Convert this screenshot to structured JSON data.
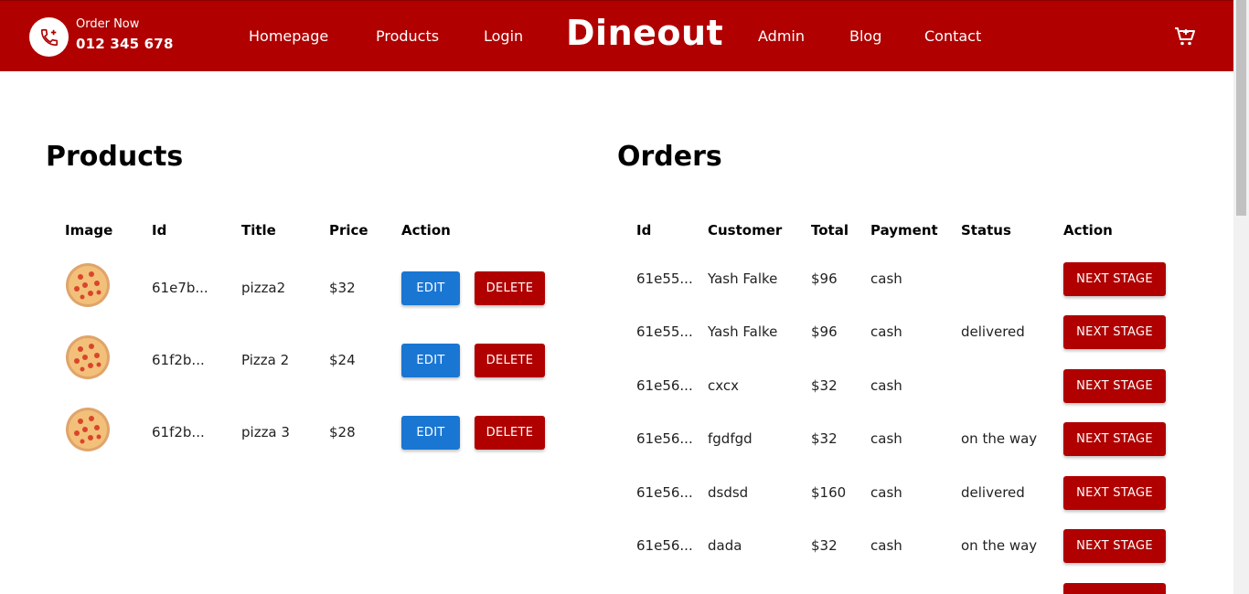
{
  "header": {
    "order_label": "Order Now",
    "phone": "012 345 678",
    "brand": "Dineout",
    "nav_left": [
      "Homepage",
      "Products",
      "Login"
    ],
    "nav_right": [
      "Admin",
      "Blog",
      "Contact"
    ],
    "accent": "#b00000"
  },
  "products": {
    "title": "Products",
    "columns": [
      "Image",
      "Id",
      "Title",
      "Price",
      "Action"
    ],
    "edit_label": "EDIT",
    "delete_label": "DELETE",
    "rows": [
      {
        "id": "61e7b...",
        "title": "pizza2",
        "price": "$32"
      },
      {
        "id": "61f2b...",
        "title": "Pizza 2",
        "price": "$24"
      },
      {
        "id": "61f2b...",
        "title": "pizza 3",
        "price": "$28"
      }
    ]
  },
  "orders": {
    "title": "Orders",
    "columns": [
      "Id",
      "Customer",
      "Total",
      "Payment",
      "Status",
      "Action"
    ],
    "next_label": "NEXT STAGE",
    "rows": [
      {
        "id": "61e55...",
        "customer": "Yash Falke",
        "total": "$96",
        "payment": "cash",
        "status": ""
      },
      {
        "id": "61e55...",
        "customer": "Yash Falke",
        "total": "$96",
        "payment": "cash",
        "status": "delivered"
      },
      {
        "id": "61e56...",
        "customer": "cxcx",
        "total": "$32",
        "payment": "cash",
        "status": ""
      },
      {
        "id": "61e56...",
        "customer": "fgdfgd",
        "total": "$32",
        "payment": "cash",
        "status": "on the way"
      },
      {
        "id": "61e56...",
        "customer": "dsdsd",
        "total": "$160",
        "payment": "cash",
        "status": "delivered"
      },
      {
        "id": "61e56...",
        "customer": "dada",
        "total": "$32",
        "payment": "cash",
        "status": "on the way"
      }
    ]
  }
}
